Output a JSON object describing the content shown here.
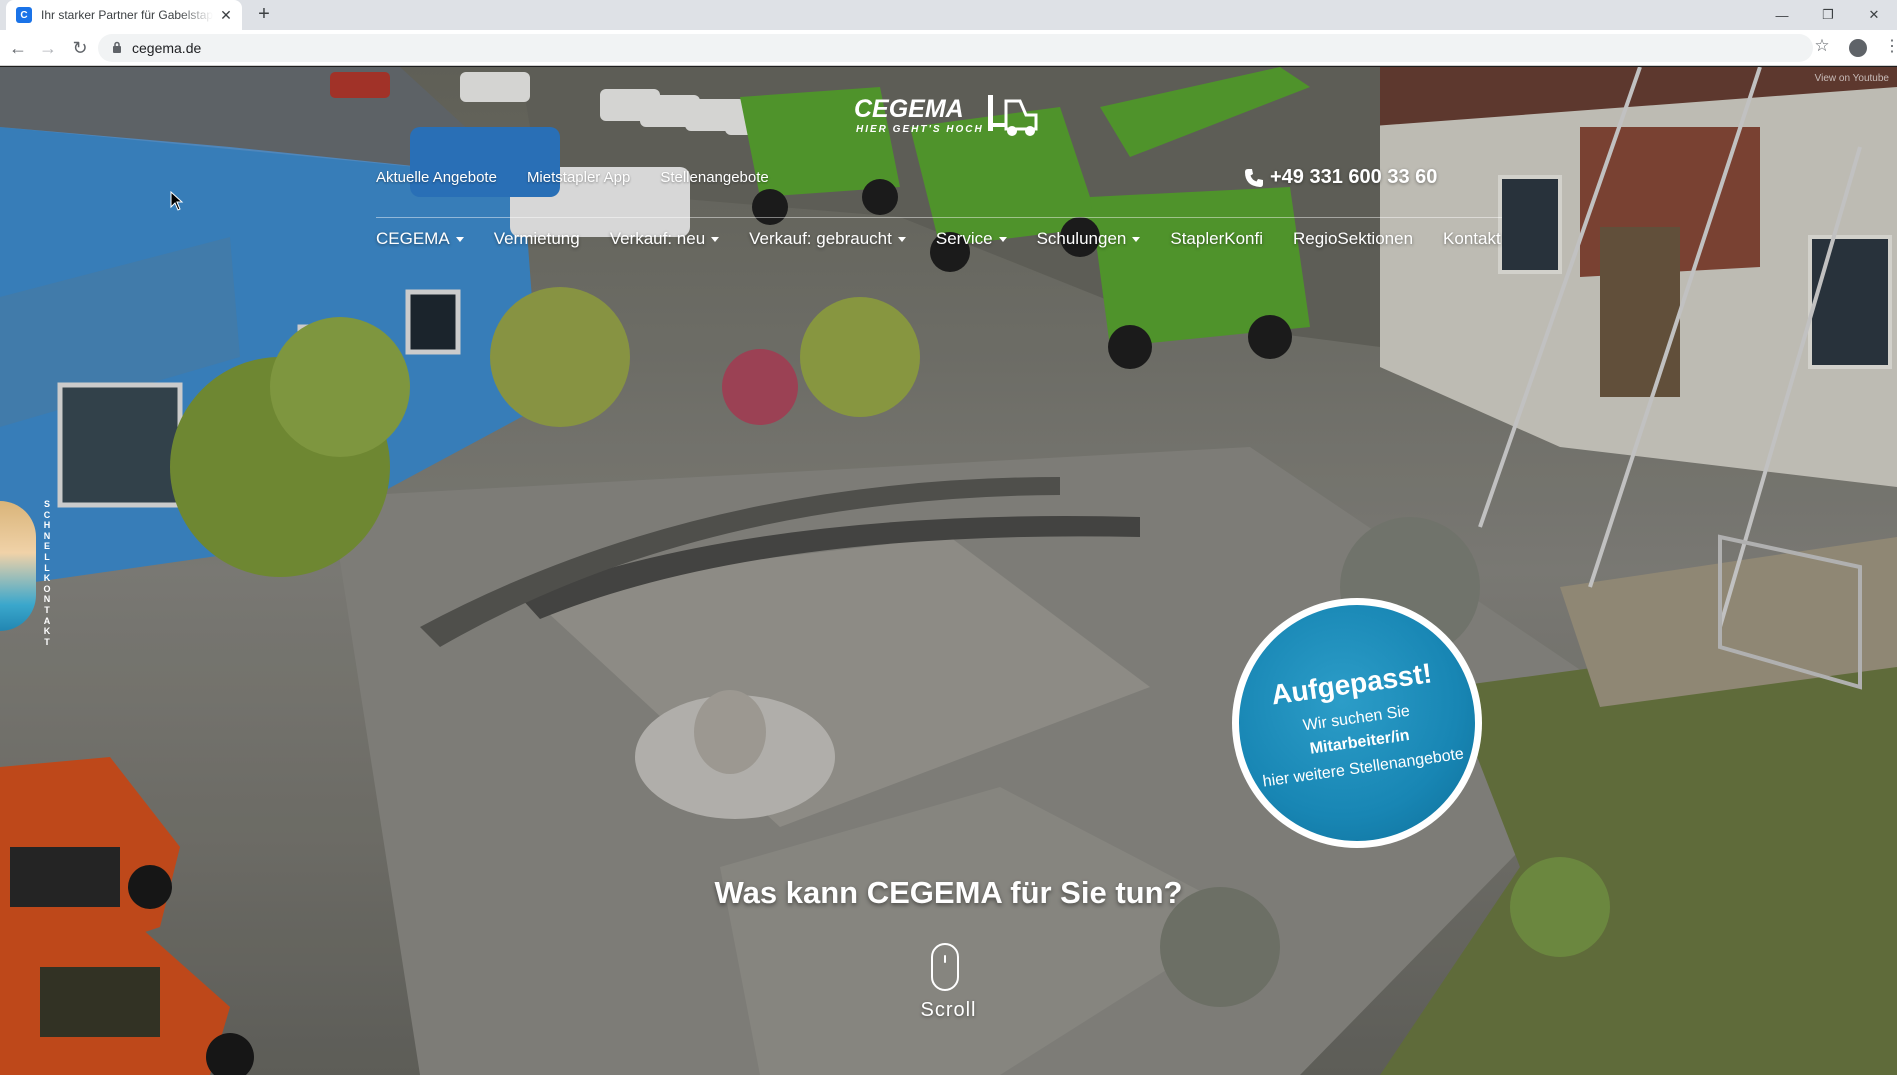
{
  "browser": {
    "tab_title": "Ihr starker Partner für Gabelstapler",
    "tab_favicon": "C",
    "tab_close": "✕",
    "new_tab": "+",
    "minimize": "—",
    "restore": "❐",
    "close": "✕",
    "url": "cegema.de",
    "back": "←",
    "forward": "→",
    "reload": "↻",
    "star": "☆",
    "menu": "⋮"
  },
  "page": {
    "youtube_hint": "View on Youtube",
    "logo": {
      "wordmark": "CEGEMA",
      "tagline": "HIER GEHT'S HOCH"
    },
    "topnav": [
      "Aktuelle Angebote",
      "Mietstapler App",
      "Stellenangebote"
    ],
    "phone": "+49 331 600 33 60",
    "mainnav": [
      {
        "label": "CEGEMA",
        "dropdown": true
      },
      {
        "label": "Vermietung",
        "dropdown": false
      },
      {
        "label": "Verkauf: neu",
        "dropdown": true
      },
      {
        "label": "Verkauf: gebraucht",
        "dropdown": true
      },
      {
        "label": "Service",
        "dropdown": true
      },
      {
        "label": "Schulungen",
        "dropdown": true
      },
      {
        "label": "StaplerKonfi",
        "dropdown": false
      },
      {
        "label": "RegioSektionen",
        "dropdown": false
      },
      {
        "label": "Kontakt",
        "dropdown": false
      }
    ],
    "quick_contact": "SCHNELLKONTAKT",
    "badge": {
      "title": "Aufgepasst!",
      "line1": "Wir suchen Sie",
      "line2": "Mitarbeiter/in",
      "line3": "hier weitere Stellenangebote"
    },
    "headline": "Was kann CEGEMA für Sie tun?",
    "scroll_label": "Scroll"
  },
  "colors": {
    "badge_blue": "#1886b4",
    "brand_green": "#5aa832",
    "forklift_orange": "#d9531e",
    "building_blue": "#3b8fd4"
  }
}
